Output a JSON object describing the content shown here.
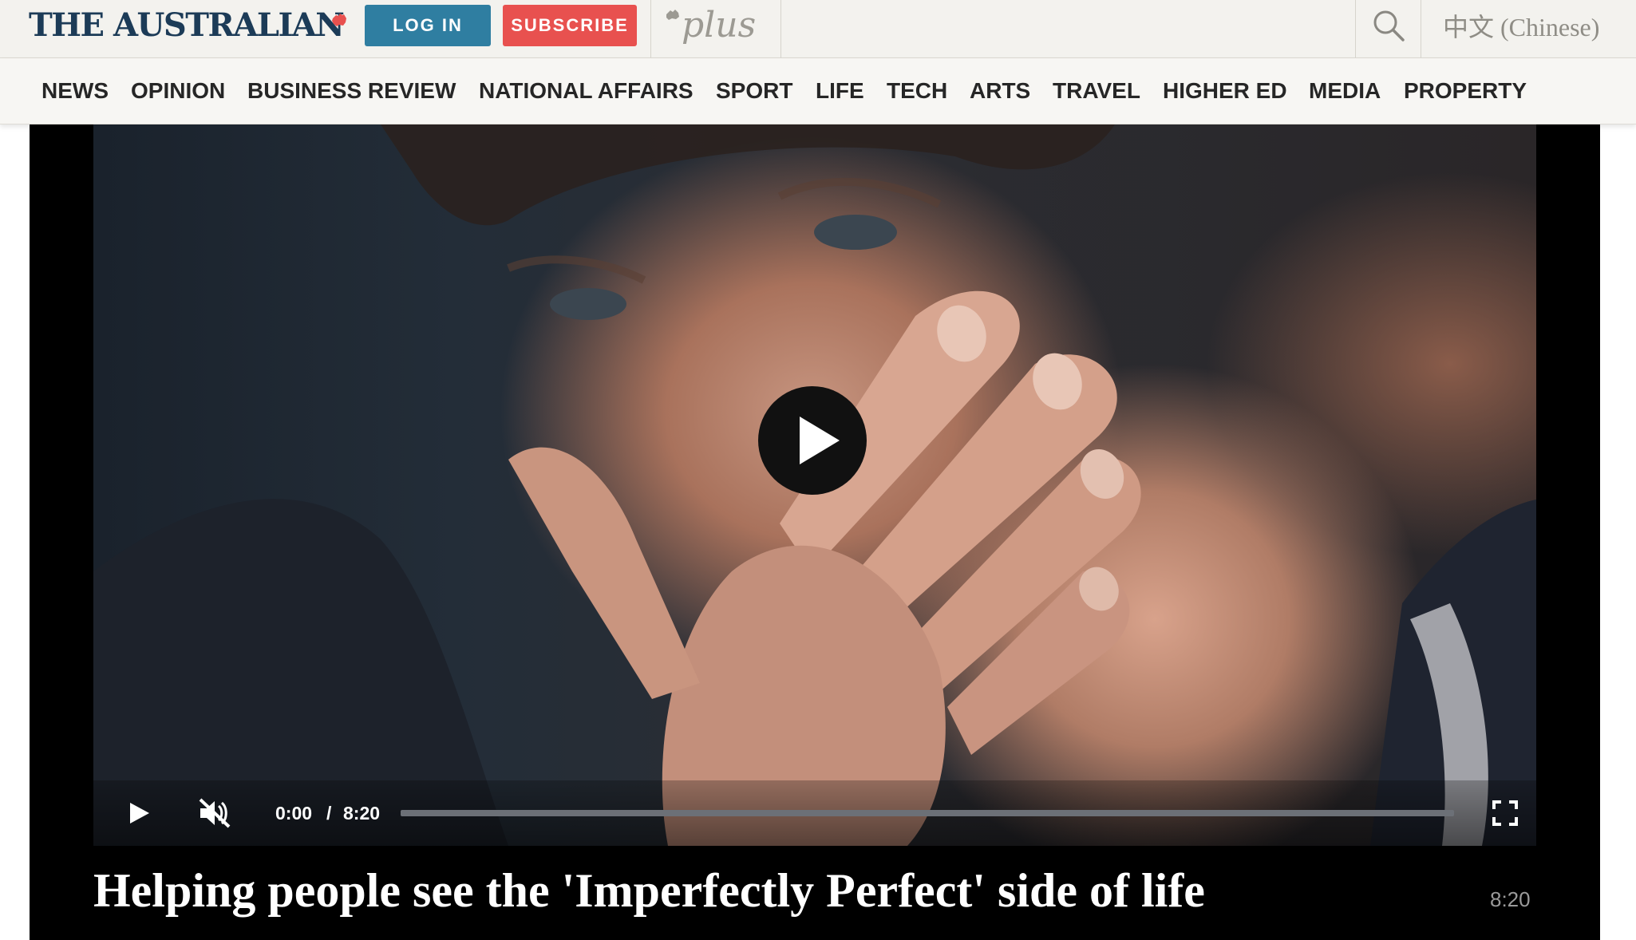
{
  "header": {
    "logo_text": "THE AUSTRALIAN",
    "login_label": "LOG IN",
    "subscribe_label": "SUBSCRIBE",
    "plus_label": "plus",
    "language_label": "中文 (Chinese)",
    "colors": {
      "brand_navy": "#1c3b57",
      "login_blue": "#2f7ea1",
      "subscribe_red": "#e8514f"
    }
  },
  "nav": {
    "items": [
      {
        "label": "NEWS"
      },
      {
        "label": "OPINION"
      },
      {
        "label": "BUSINESS REVIEW"
      },
      {
        "label": "NATIONAL AFFAIRS"
      },
      {
        "label": "SPORT"
      },
      {
        "label": "LIFE"
      },
      {
        "label": "TECH"
      },
      {
        "label": "ARTS"
      },
      {
        "label": "TRAVEL"
      },
      {
        "label": "HIGHER ED"
      },
      {
        "label": "MEDIA"
      },
      {
        "label": "PROPERTY"
      }
    ]
  },
  "video": {
    "current_time": "0:00",
    "time_separator": "/",
    "duration": "8:20",
    "progress_fraction": 0,
    "muted": true,
    "title": "Helping people see the 'Imperfectly Perfect' side of life",
    "duration_badge": "8:20",
    "icons": [
      "play-icon",
      "muted-speaker-icon",
      "fullscreen-icon",
      "search-icon"
    ]
  }
}
